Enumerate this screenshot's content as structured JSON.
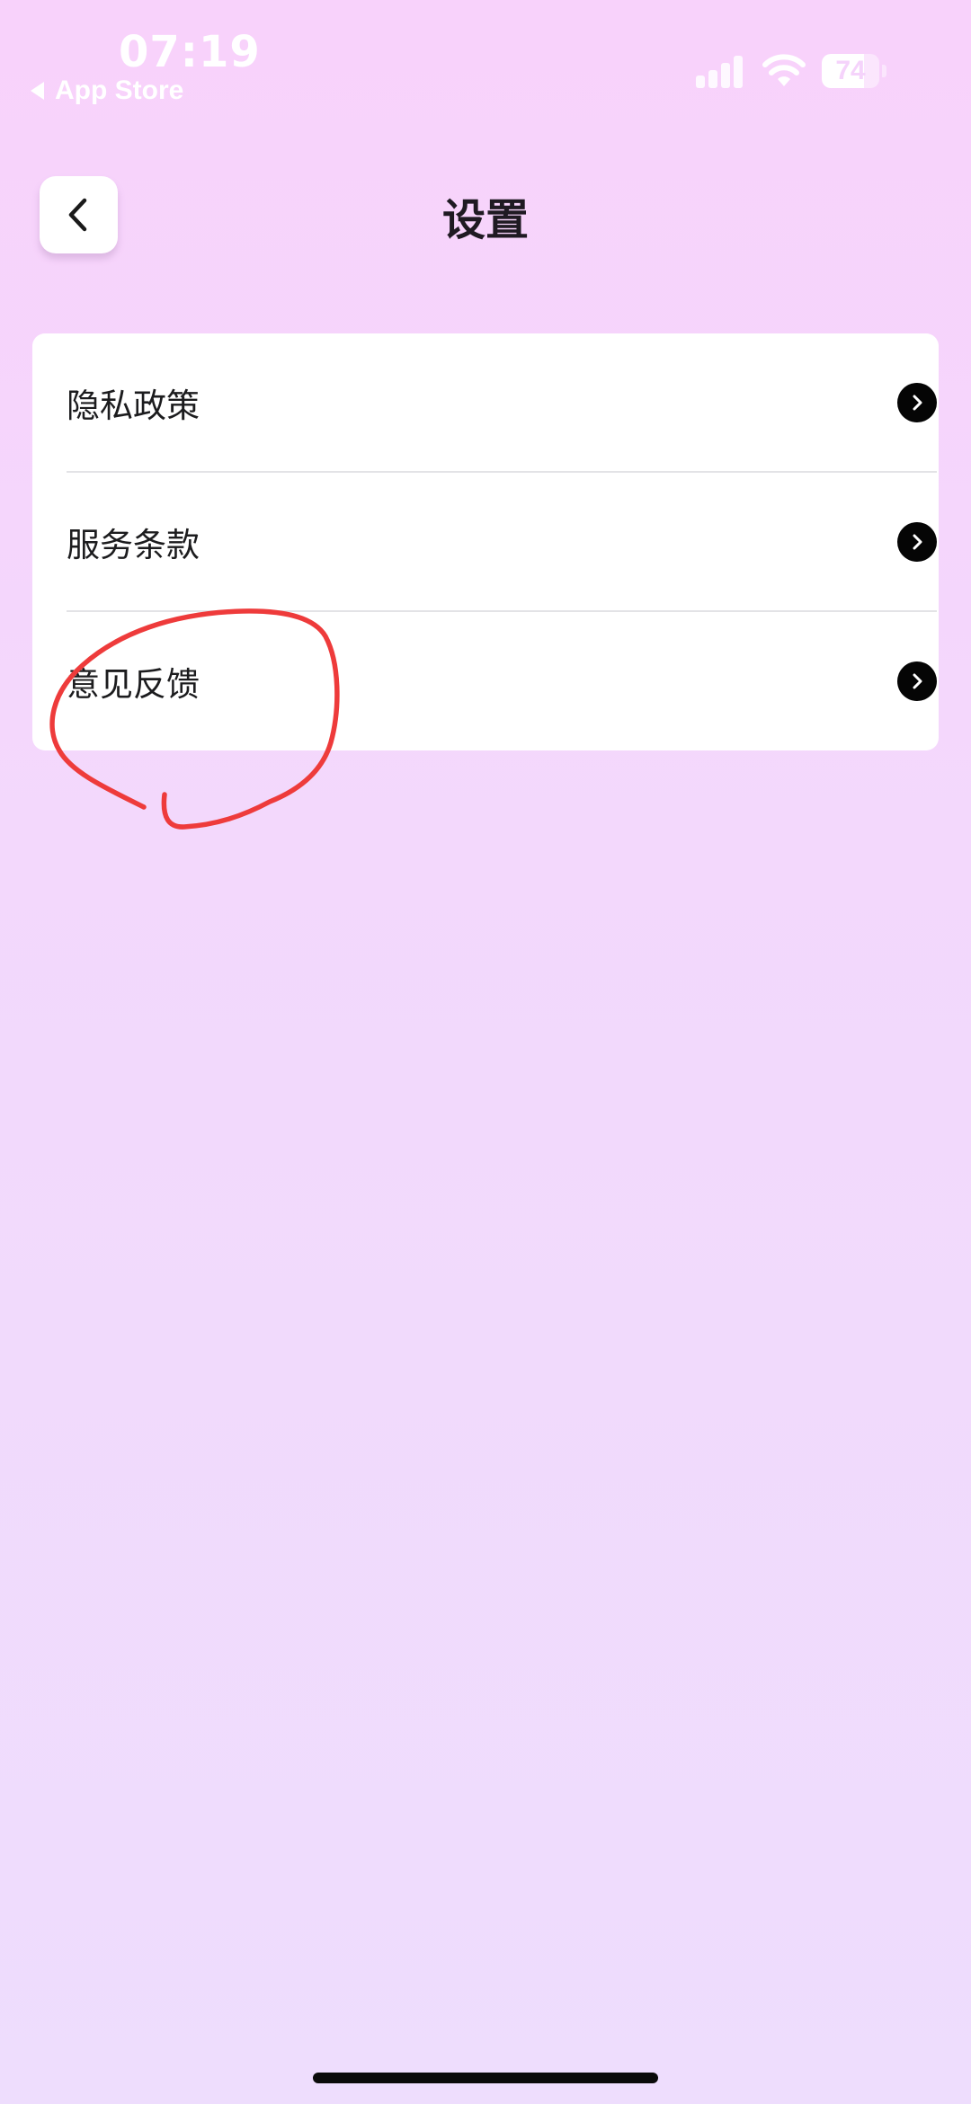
{
  "status_bar": {
    "time": "07:19",
    "back_app": "App Store",
    "battery_percent": "74",
    "battery_level": 0.74
  },
  "header": {
    "title": "设置"
  },
  "settings": {
    "items": [
      {
        "label": "隐私政策"
      },
      {
        "label": "服务条款"
      },
      {
        "label": "意见反馈"
      }
    ]
  },
  "colors": {
    "background_top": "#F8D2FB",
    "background_bottom": "#EEDDFD",
    "card": "#FFFFFF",
    "chevron_circle": "#050505",
    "annotation_stroke": "#EE3B3B"
  },
  "icons": {
    "back": "chevron-left-icon",
    "row_arrow": "chevron-right-circle-icon",
    "signal": "cellular-signal-icon",
    "wifi": "wifi-icon",
    "battery": "battery-icon"
  }
}
